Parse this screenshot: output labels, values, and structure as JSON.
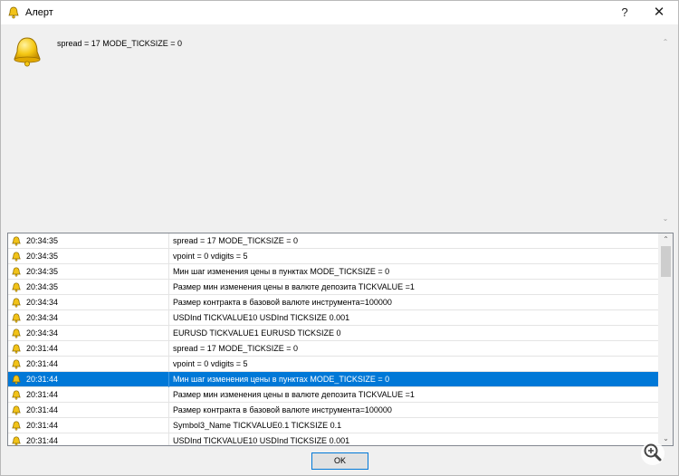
{
  "window": {
    "title": "Алерт"
  },
  "titlebar": {
    "help_label": "?",
    "close_label": "✕"
  },
  "message": {
    "text": "spread = 17 MODE_TICKSIZE = 0"
  },
  "scrollbar": {
    "up": "⌃",
    "down": "⌄"
  },
  "alerts": [
    {
      "time": "20:34:35",
      "message": " spread = 17 MODE_TICKSIZE = 0",
      "selected": false
    },
    {
      "time": "20:34:35",
      "message": " vpoint = 0 vdigits = 5",
      "selected": false
    },
    {
      "time": "20:34:35",
      "message": "Мин шаг изменения цены в пунктах MODE_TICKSIZE = 0",
      "selected": false
    },
    {
      "time": "20:34:35",
      "message": "Размер мин изменения цены в валюте депозита TICKVALUE =1",
      "selected": false
    },
    {
      "time": "20:34:34",
      "message": "Размер контракта в базовой валюте инструмента=100000",
      "selected": false
    },
    {
      "time": "20:34:34",
      "message": "USDInd TICKVALUE10 USDInd TICKSIZE 0.001",
      "selected": false
    },
    {
      "time": "20:34:34",
      "message": "EURUSD TICKVALUE1 EURUSD TICKSIZE 0",
      "selected": false
    },
    {
      "time": "20:31:44",
      "message": " spread = 17 MODE_TICKSIZE = 0",
      "selected": false
    },
    {
      "time": "20:31:44",
      "message": " vpoint = 0 vdigits = 5",
      "selected": false
    },
    {
      "time": "20:31:44",
      "message": "Мин шаг изменения цены в пунктах MODE_TICKSIZE = 0",
      "selected": true
    },
    {
      "time": "20:31:44",
      "message": "Размер мин изменения цены в валюте депозита TICKVALUE =1",
      "selected": false
    },
    {
      "time": "20:31:44",
      "message": "Размер контракта в базовой валюте инструмента=100000",
      "selected": false
    },
    {
      "time": "20:31:44",
      "message": "Symbol3_Name TICKVALUE0.1 TICKSIZE 0.1",
      "selected": false
    },
    {
      "time": "20:31:44",
      "message": "USDInd TICKVALUE10 USDInd TICKSIZE 0.001",
      "selected": false
    }
  ],
  "footer": {
    "ok_label": "OK"
  },
  "colors": {
    "selection": "#0078d7",
    "bell": "#f2c318"
  }
}
